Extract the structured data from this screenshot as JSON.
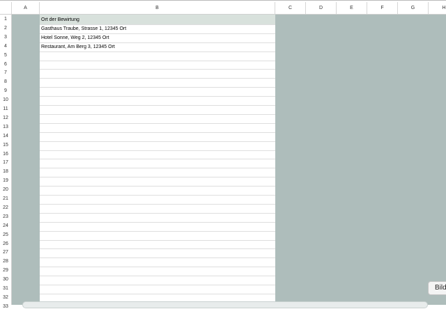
{
  "columns": [
    "A",
    "B",
    "C",
    "D",
    "E",
    "F",
    "G",
    "H"
  ],
  "rows": [
    "1",
    "2",
    "3",
    "4",
    "5",
    "6",
    "7",
    "8",
    "9",
    "10",
    "11",
    "12",
    "13",
    "14",
    "15",
    "16",
    "17",
    "18",
    "19",
    "20",
    "21",
    "22",
    "23",
    "24",
    "25",
    "26",
    "27",
    "28",
    "29",
    "30",
    "31",
    "32",
    "33"
  ],
  "cells": {
    "B1": "Ort der Bewirtung",
    "B2": "Gasthaus Traube, Strasse 1, 12345 Ort",
    "B3": "Hotel Sonne, Weg 2, 12345 Ort",
    "B4": "Restaurant, Am Berg 3, 12345 Ort"
  },
  "button": {
    "label": "Bild"
  },
  "colors": {
    "background": "#aebdbb",
    "header_cell": "#d8e1dc"
  }
}
